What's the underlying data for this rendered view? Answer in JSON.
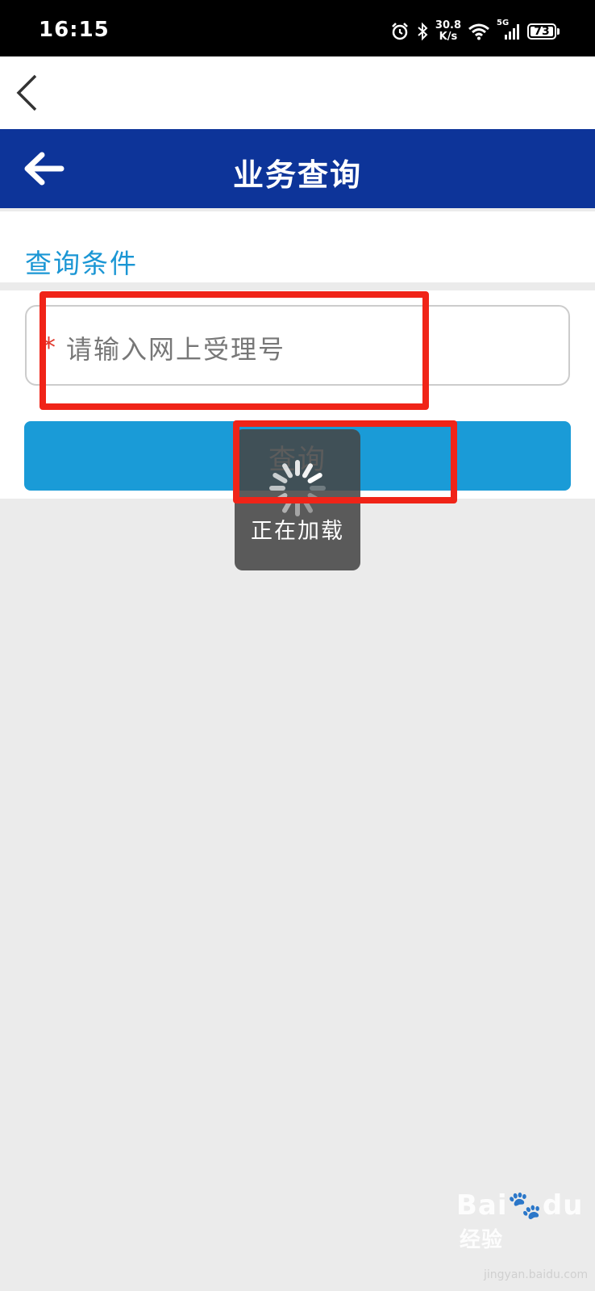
{
  "status_bar": {
    "time": "16:15",
    "net_speed_value": "30.8",
    "net_speed_unit": "K/s",
    "network": "5G",
    "battery": "73",
    "icons": [
      "alarm-icon",
      "bluetooth-icon",
      "wifi-icon",
      "signal-icon",
      "battery-icon"
    ]
  },
  "title_bar": {
    "title": "业务查询",
    "color": "#0d3499"
  },
  "section": {
    "title": "查询条件"
  },
  "form": {
    "required_mark": "*",
    "placeholder": "请输入网上受理号",
    "query_button": "查询",
    "button_color": "#1a9bd7"
  },
  "loading": {
    "text": "正在加载"
  },
  "annotation": {
    "highlight_color": "#f02418"
  },
  "watermark": {
    "brand": "Bai",
    "brand_b": "du",
    "cn": "经验",
    "url": "jingyan.baidu.com"
  }
}
